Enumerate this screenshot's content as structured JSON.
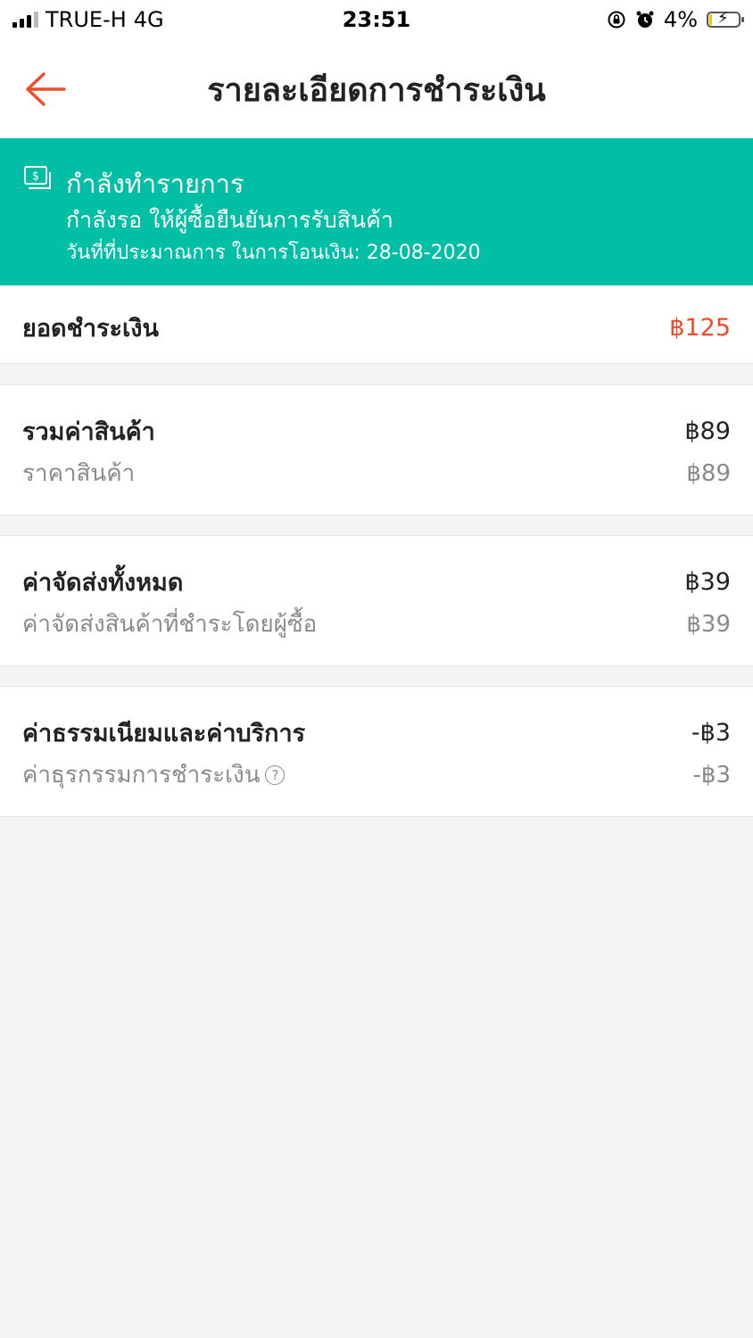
{
  "status_bar": {
    "carrier": "TRUE-H",
    "network": "4G",
    "time": "23:51",
    "battery": "4%",
    "icons": [
      "signal-icon",
      "orientation-lock-icon",
      "alarm-icon",
      "battery-charging-icon"
    ]
  },
  "header": {
    "title": "รายละเอียดการชำระเงิน",
    "back_icon": "arrow-left-icon"
  },
  "banner": {
    "icon": "money-icon",
    "title": "กำลังทำรายการ",
    "subtitle": "กำลังรอ ให้ผู้ซื้อยืนยันการรับสินค้า",
    "date_text": "วันที่ที่ประมาณการ ในการโอนเงิน: 28-08-2020"
  },
  "total": {
    "label": "ยอดชำระเงิน",
    "value": "฿125"
  },
  "sections": [
    {
      "label": "รวมค่าสินค้า",
      "value": "฿89",
      "detail_label": "ราคาสินค้า",
      "detail_value": "฿89"
    },
    {
      "label": "ค่าจัดส่งทั้งหมด",
      "value": "฿39",
      "detail_label": "ค่าจัดส่งสินค้าที่ชำระโดยผู้ซื้อ",
      "detail_value": "฿39"
    },
    {
      "label": "ค่าธรรมเนียมและค่าบริการ",
      "value": "-฿3",
      "detail_label": "ค่าธุรกรรมการชำระเงิน",
      "detail_value": "-฿3",
      "help_glyph": "?"
    }
  ],
  "colors": {
    "accent": "#ee4d2d",
    "banner": "#00bfa5",
    "background": "#f4f4f4"
  }
}
